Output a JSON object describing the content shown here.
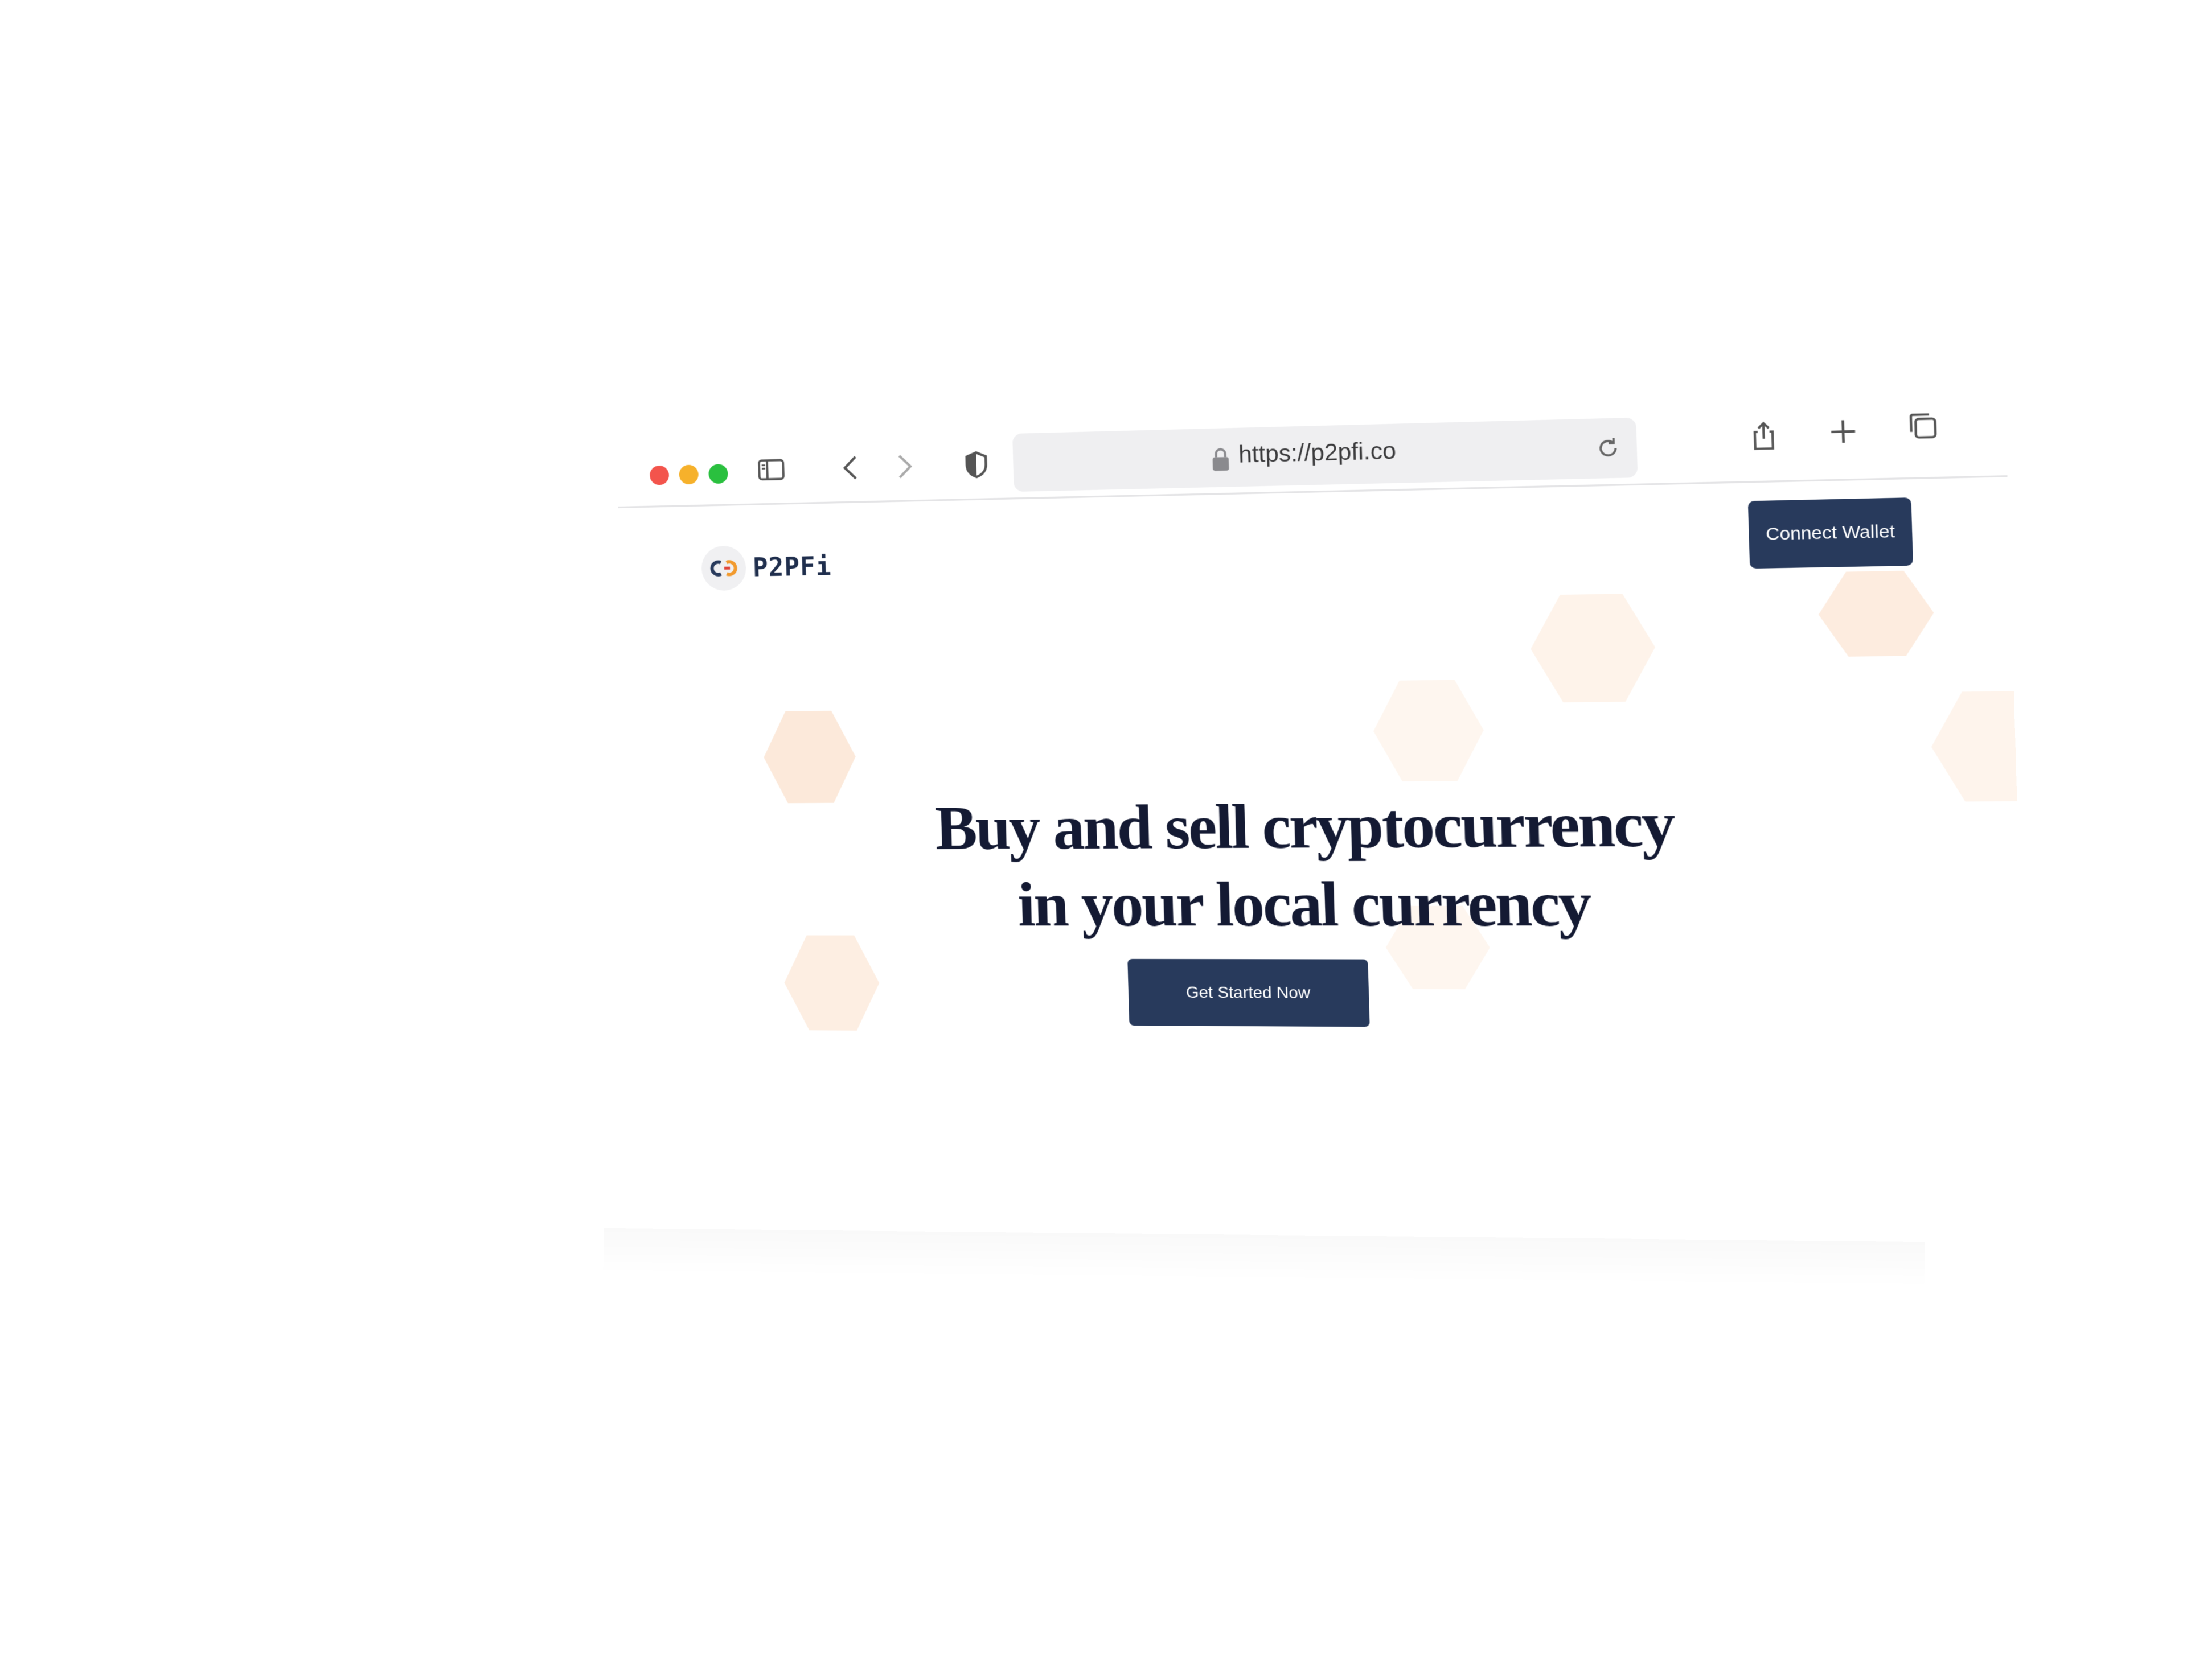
{
  "browser": {
    "url": "https://p2pfi.co",
    "icons": [
      "sidebar-icon",
      "back-icon",
      "forward-icon",
      "shield-icon",
      "lock-icon",
      "reload-icon",
      "share-icon",
      "new-tab-icon",
      "tabs-overview-icon"
    ]
  },
  "site": {
    "logo_text": "P2PFi",
    "connect_wallet_label": "Connect Wallet",
    "headline_line1": "Buy and sell cryptocurrency",
    "headline_line2": "in your local currency",
    "cta_label": "Get Started Now"
  },
  "colors": {
    "accent_navy": "#283a5c",
    "headline": "#141a33",
    "hexagon": "#fdeee0"
  }
}
